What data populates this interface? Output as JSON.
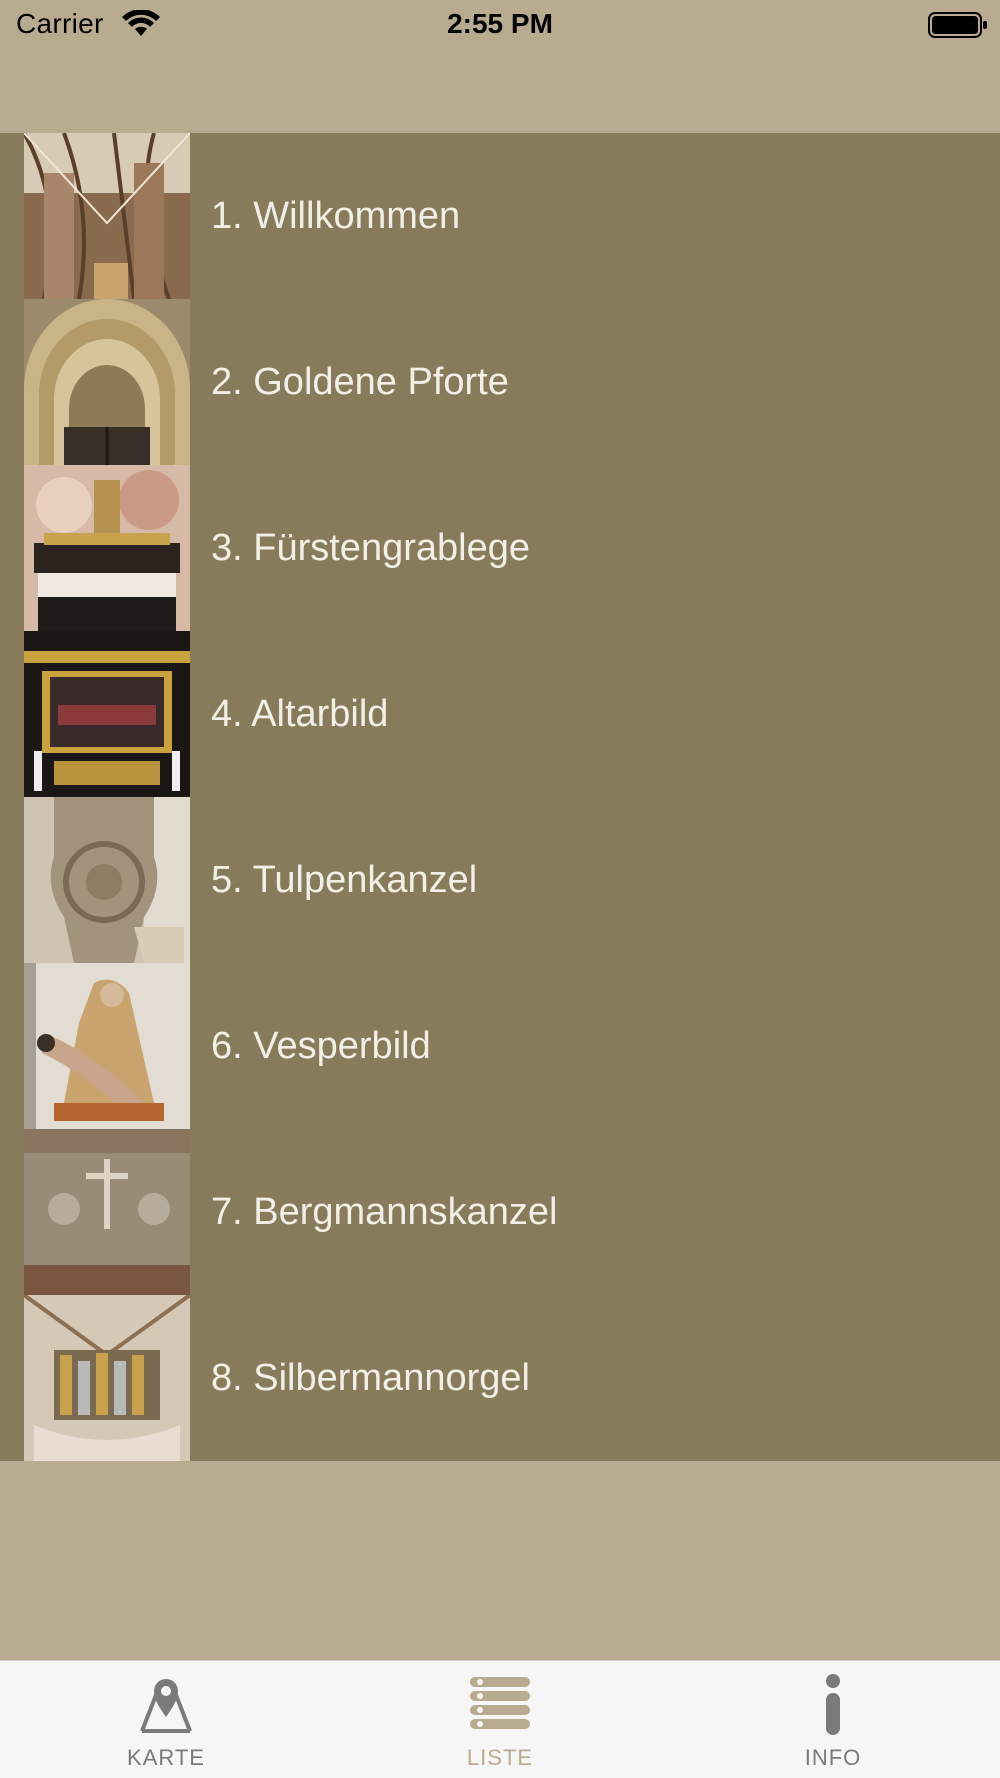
{
  "status_bar": {
    "carrier": "Carrier",
    "time": "2:55 PM"
  },
  "stops": [
    {
      "label": "1. Willkommen",
      "icon": "church-nave-vault-thumbnail"
    },
    {
      "label": "2. Goldene Pforte",
      "icon": "golden-portal-thumbnail"
    },
    {
      "label": "3. Fürstengrablege",
      "icon": "princely-tomb-thumbnail"
    },
    {
      "label": "4. Altarbild",
      "icon": "altarpiece-thumbnail"
    },
    {
      "label": "5. Tulpenkanzel",
      "icon": "tulip-pulpit-thumbnail"
    },
    {
      "label": "6. Vesperbild",
      "icon": "pieta-thumbnail"
    },
    {
      "label": "7. Bergmannskanzel",
      "icon": "miners-pulpit-thumbnail"
    },
    {
      "label": "8. Silbermannorgel",
      "icon": "silbermann-organ-thumbnail"
    }
  ],
  "tabs": [
    {
      "label": "KARTE",
      "icon": "map-pin-icon",
      "selected": false
    },
    {
      "label": "LISTE",
      "icon": "list-icon",
      "selected": true
    },
    {
      "label": "INFO",
      "icon": "info-icon",
      "selected": false
    }
  ],
  "colors": {
    "background": "#b9ab8f",
    "list_background": "#877b5c",
    "list_text": "#f3efe6",
    "tab_selected": "#b9ab8f",
    "tab_unselected": "#7a7a7a"
  }
}
